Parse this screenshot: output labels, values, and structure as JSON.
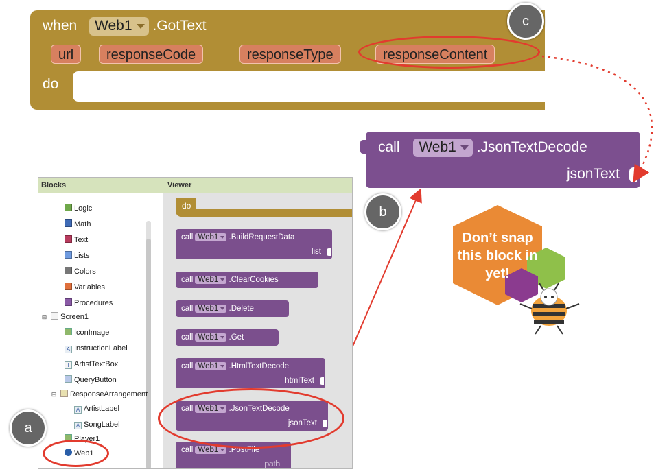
{
  "event_block": {
    "keyword_when": "when",
    "component": "Web1",
    "event": ".GotText",
    "params": [
      "url",
      "responseCode",
      "responseType",
      "responseContent"
    ],
    "keyword_do": "do"
  },
  "call_block": {
    "keyword_call": "call",
    "component": "Web1",
    "method": ".JsonTextDecode",
    "arg": "jsonText"
  },
  "callouts": {
    "a": "a",
    "b": "b",
    "c": "c"
  },
  "badge": {
    "line1": "Don’t snap",
    "line2": "this block in",
    "line3": "yet!"
  },
  "panel": {
    "blocks_header": "Blocks",
    "viewer_header": "Viewer",
    "builtin": [
      {
        "label": "Logic",
        "color": "#6fa84a"
      },
      {
        "label": "Math",
        "color": "#3f6bb6"
      },
      {
        "label": "Text",
        "color": "#b83b5e"
      },
      {
        "label": "Lists",
        "color": "#6f9be0"
      },
      {
        "label": "Colors",
        "color": "#777777"
      },
      {
        "label": "Variables",
        "color": "#e0703c"
      },
      {
        "label": "Procedures",
        "color": "#8a5aa6"
      }
    ],
    "screen": "Screen1",
    "components": [
      "IconImage",
      "InstructionLabel",
      "ArtistTextBox",
      "QueryButton"
    ],
    "arrangement": "ResponseArrangement",
    "arrangement_children": [
      "ArtistLabel",
      "SongLabel"
    ],
    "partial_item": "Player1",
    "web_item": "Web1",
    "viewer_do": "do",
    "viewer_blocks": [
      {
        "keyword": "call",
        "component": "Web1",
        "method": ".BuildRequestData",
        "arg": "list"
      },
      {
        "keyword": "call",
        "component": "Web1",
        "method": ".ClearCookies",
        "arg": ""
      },
      {
        "keyword": "call",
        "component": "Web1",
        "method": ".Delete",
        "arg": ""
      },
      {
        "keyword": "call",
        "component": "Web1",
        "method": ".Get",
        "arg": ""
      },
      {
        "keyword": "call",
        "component": "Web1",
        "method": ".HtmlTextDecode",
        "arg": "htmlText"
      },
      {
        "keyword": "call",
        "component": "Web1",
        "method": ".JsonTextDecode",
        "arg": "jsonText"
      },
      {
        "keyword": "call",
        "component": "Web1",
        "method": ".PostFile",
        "arg": "path"
      }
    ]
  },
  "colors": {
    "event_block": "#b18e35",
    "procedure_block": "#7c4f8f",
    "param": "#d7805f",
    "highlight": "#e23b2e",
    "panel_header": "#d6e3bc",
    "badge_orange": "#ea8a35"
  }
}
